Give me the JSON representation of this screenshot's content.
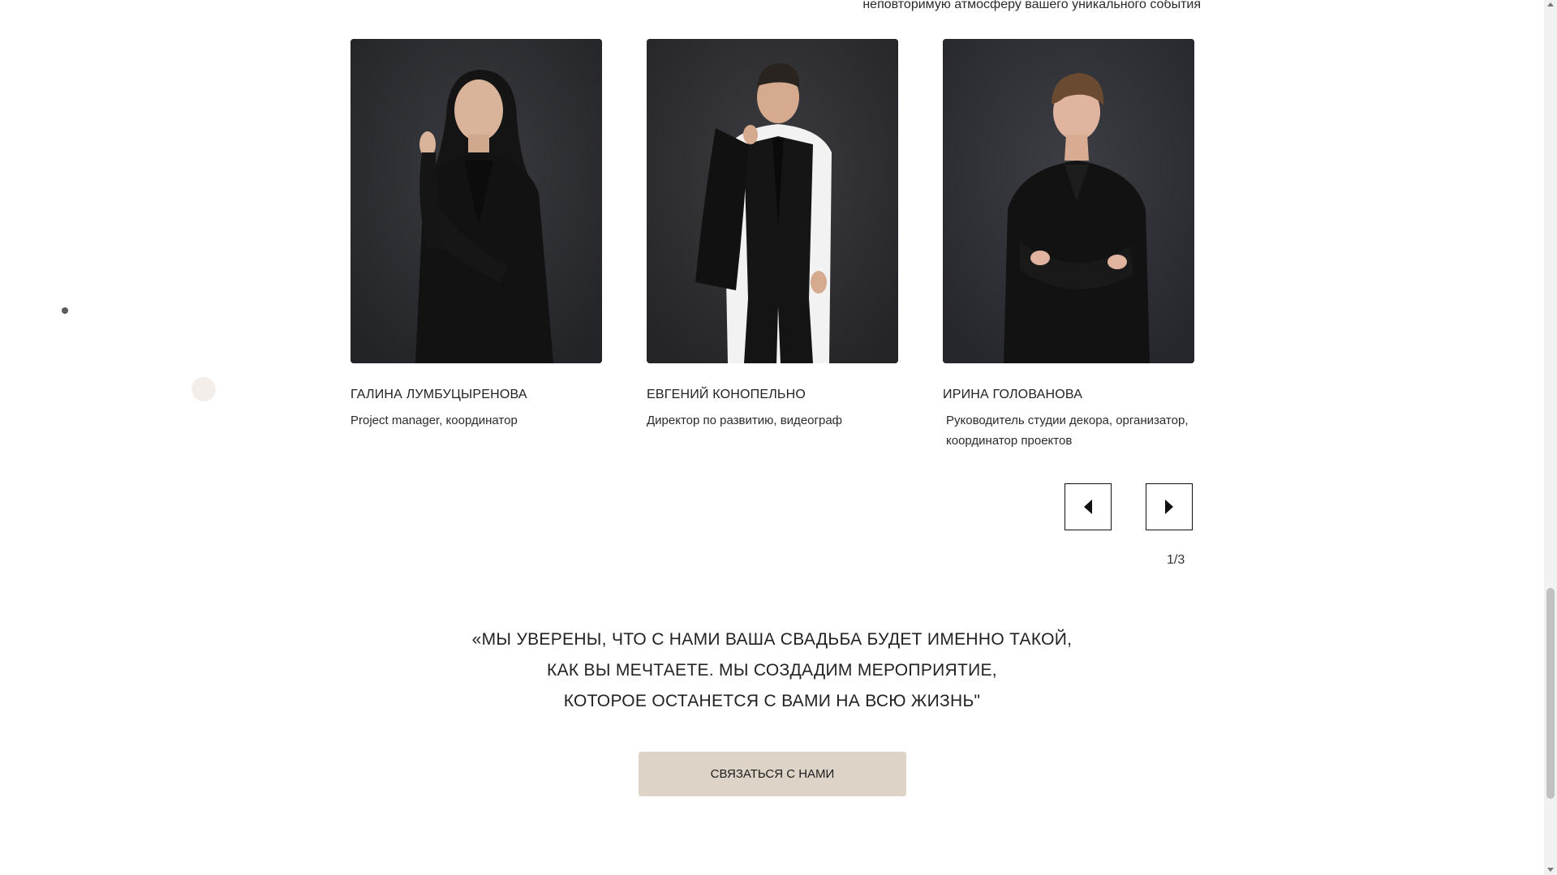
{
  "section": {
    "caption": "неповторимую атмосферу вашего уникального события"
  },
  "team": [
    {
      "name": "ГАЛИНА ЛУМБУЦЫРЕНОВА",
      "role": "Project manager, координатор"
    },
    {
      "name": "ЕВГЕНИЙ КОНОПЕЛЬНО",
      "role": "Директор по развитию, видеограф"
    },
    {
      "name": "ИРИНА ГОЛОВАНОВА",
      "role": "Руководитель студии декора, организатор, координатор проектов"
    }
  ],
  "slider": {
    "prev_icon": "chevron-left-icon",
    "next_icon": "chevron-right-icon",
    "counter": "1/3"
  },
  "quote": {
    "line1": "«МЫ УВЕРЕНЫ, ЧТО С НАМИ ВАША СВАДЬБА БУДЕТ ИМЕННО ТАКОЙ,",
    "line2": "КАК ВЫ МЕЧТАЕТЕ. МЫ СОЗДАДИМ МЕРОПРИЯТИЕ,",
    "line3": "КОТОРОЕ ОСТАНЕТСЯ С ВАМИ НА ВСЮ ЖИЗНЬ\""
  },
  "cta": {
    "label": "СВЯЗАТЬСЯ С НАМИ"
  },
  "colors": {
    "cta_bg": "#ddd3c6",
    "photo_bg": "#2c2d31",
    "accent_dot": "#f3eeea"
  }
}
